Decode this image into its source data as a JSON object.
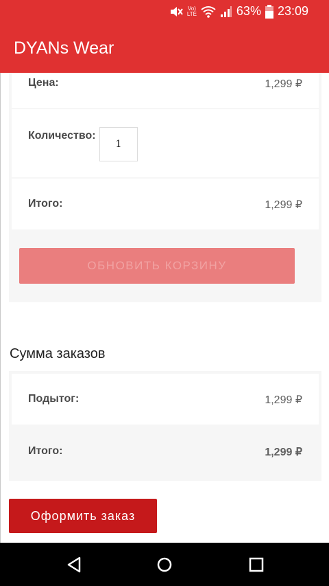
{
  "status_bar": {
    "battery_percent": "63%",
    "time": "23:09",
    "volte": "Vo)",
    "lte": "LTE",
    "icons": [
      "mute-icon",
      "volte-icon",
      "wifi-icon",
      "signal-icon",
      "battery-icon"
    ]
  },
  "app": {
    "title": "DYANs Wear"
  },
  "cart": {
    "price_label": "Цена:",
    "price_value": "1,299 ₽",
    "quantity_label": "Количество:",
    "quantity_value": "1",
    "total_label": "Итого:",
    "total_value": "1,299 ₽",
    "update_button": "ОБНОВИТЬ КОРЗИНУ"
  },
  "summary": {
    "title": "Сумма заказов",
    "subtotal_label": "Подытог:",
    "subtotal_value": "1,299 ₽",
    "total_label": "Итого:",
    "total_value": "1,299 ₽"
  },
  "checkout_button": "Оформить заказ",
  "nav": {
    "icons": [
      "back-icon",
      "home-icon",
      "recents-icon"
    ]
  },
  "colors": {
    "brand": "#e03131",
    "button_disabled": "#ea7e7e",
    "checkout": "#c5191b"
  }
}
